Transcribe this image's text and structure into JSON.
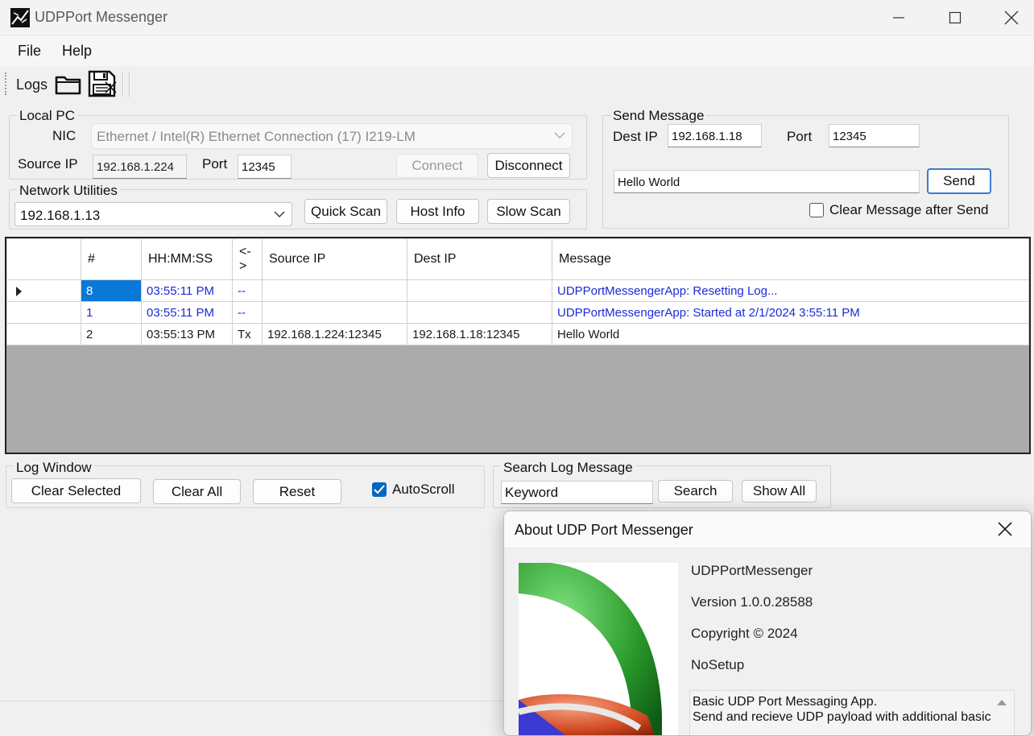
{
  "window": {
    "title": "UDPPort Messenger",
    "icon": "app-icon",
    "minimize_icon": "minimize-icon",
    "maximize_icon": "maximize-icon",
    "close_icon": "close-icon"
  },
  "menu": [
    "File",
    "Help"
  ],
  "toolbar": {
    "logs_label": "Logs",
    "open_icon": "folder-open-icon",
    "save_icon": "save-icon"
  },
  "local_pc": {
    "title": "Local PC",
    "nic_label": "NIC",
    "nic_value": "Ethernet / Intel(R) Ethernet Connection (17) I219-LM",
    "source_ip_label": "Source IP",
    "source_ip": "192.168.1.224",
    "port_label": "Port",
    "port": "12345",
    "connect": "Connect",
    "disconnect": "Disconnect"
  },
  "network_utilities": {
    "title": "Network Utilities",
    "selected_ip": "192.168.1.13",
    "quick_scan": "Quick Scan",
    "host_info": "Host Info",
    "slow_scan": "Slow Scan"
  },
  "send_message": {
    "title": "Send Message",
    "dest_ip_label": "Dest IP",
    "dest_ip": "192.168.1.18",
    "port_label": "Port",
    "port": "12345",
    "message": "Hello World",
    "send": "Send",
    "clear_after_send": "Clear Message after Send",
    "clear_after_send_checked": false
  },
  "log_table": {
    "columns": [
      "#",
      "HH:MM:SS",
      "<->",
      "Source IP",
      "Dest IP",
      "Message"
    ],
    "rows": [
      {
        "current": true,
        "blue": true,
        "num": "8",
        "time": "03:55:11 PM",
        "dir": "--",
        "src": "",
        "dst": "",
        "msg": "UDPPortMessengerApp: Resetting Log..."
      },
      {
        "current": false,
        "blue": true,
        "num": "1",
        "time": "03:55:11 PM",
        "dir": "--",
        "src": "",
        "dst": "",
        "msg": "UDPPortMessengerApp: Started at 2/1/2024 3:55:11 PM"
      },
      {
        "current": false,
        "blue": false,
        "num": "2",
        "time": "03:55:13 PM",
        "dir": "Tx",
        "src": "192.168.1.224:12345",
        "dst": "192.168.1.18:12345",
        "msg": "Hello World"
      }
    ]
  },
  "log_window": {
    "title": "Log Window",
    "clear_selected": "Clear Selected",
    "clear_all": "Clear All",
    "reset": "Reset",
    "autoscroll": "AutoScroll",
    "autoscroll_checked": true
  },
  "search": {
    "title": "Search Log Message",
    "keyword": "Keyword",
    "search": "Search",
    "show_all": "Show All"
  },
  "about": {
    "title": "About UDP Port Messenger",
    "product": "UDPPortMessenger",
    "version": "Version 1.0.0.28588",
    "copyright": "Copyright ©  2024",
    "company": "NoSetup",
    "description_line1": "Basic UDP Port Messaging App.",
    "description_line2": "Send and recieve UDP payload with additional basic"
  },
  "colors": {
    "selection": "#0a78d7",
    "system_text": "#1a2bd6",
    "grid_empty": "#ababab",
    "accent_button": "#3b7bd0"
  }
}
